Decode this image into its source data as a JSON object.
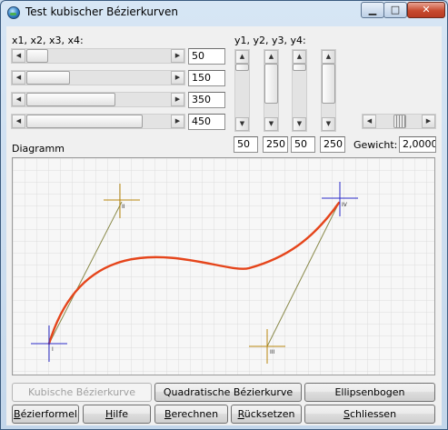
{
  "window": {
    "title": "Test kubischer Bézierkurven",
    "caption_buttons": {
      "minimize": "▁",
      "maximize": "□",
      "close": "✕"
    }
  },
  "labels": {
    "x_group": "x1, x2, x3, x4:",
    "y_group": "y1, y2, y3, y4:",
    "diagram": "Diagramm",
    "weight": "Gewicht:"
  },
  "x_values": [
    "50",
    "150",
    "350",
    "450"
  ],
  "y_values": [
    "50",
    "250",
    "50",
    "250"
  ],
  "weight_value": "2,0000",
  "point_labels": [
    "I",
    "II",
    "III",
    "IV"
  ],
  "icons": {
    "left": "◀",
    "right": "▶",
    "up": "▲",
    "down": "▼"
  },
  "buttons_row1": {
    "cubic": "Kubische Bézierkurve",
    "quadratic": "Quadratische Bézierkurve",
    "ellipse": "Ellipsenbogen"
  },
  "buttons_row2": {
    "formula": {
      "mnemonic": "B",
      "rest": "ézierformel"
    },
    "help": {
      "mnemonic": "H",
      "rest": "ilfe"
    },
    "calculate": {
      "mnemonic": "B",
      "rest": "erechnen"
    },
    "reset": {
      "mnemonic": "R",
      "rest": "ücksetzen"
    },
    "close": {
      "mnemonic": "S",
      "rest": "chliessen"
    }
  },
  "colors": {
    "curve": "#e5451b",
    "control_line": "#8a8a4a",
    "endpoint_marker": "#2b2bc8",
    "control_marker": "#b8870f",
    "grid": "#dcdcdc"
  }
}
